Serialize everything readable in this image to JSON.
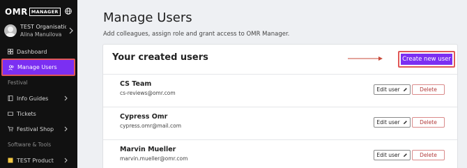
{
  "brand": {
    "name": "OMR",
    "product": "MANAGER"
  },
  "profile": {
    "organisation": "TEST Organisation",
    "user": "Alina Manuilova"
  },
  "sidebar": {
    "items": [
      {
        "label": "Dashboard",
        "icon": "dashboard-icon"
      },
      {
        "label": "Manage Users",
        "icon": "users-icon",
        "active": true
      },
      {
        "label": "Festival",
        "section": true
      },
      {
        "label": "Info Guides",
        "icon": "book-icon",
        "chevron": true
      },
      {
        "label": "Tickets",
        "icon": "ticket-icon"
      },
      {
        "label": "Festival Shop",
        "icon": "cart-icon",
        "chevron": true
      },
      {
        "label": "Software & Tools",
        "section": true
      },
      {
        "label": "TEST Product",
        "icon": "product-icon",
        "chevron": true
      }
    ]
  },
  "page": {
    "title": "Manage Users",
    "subtitle": "Add colleagues, assign role and grant access to OMR Manager."
  },
  "card": {
    "title": "Your created users",
    "create_label": "Create new user",
    "edit_label": "Edit user",
    "delete_label": "Delete",
    "users": [
      {
        "name": "CS Team",
        "email": "cs-reviews@omr.com"
      },
      {
        "name": "Cypress Omr",
        "email": "cypress.omr@mail.com"
      },
      {
        "name": "Marvin Mueller",
        "email": "marvin.mueller@omr.com"
      }
    ]
  },
  "colors": {
    "accent": "#7b2ff2",
    "highlight": "#e05757",
    "sidebar": "#111111",
    "background": "#eef0f3"
  }
}
